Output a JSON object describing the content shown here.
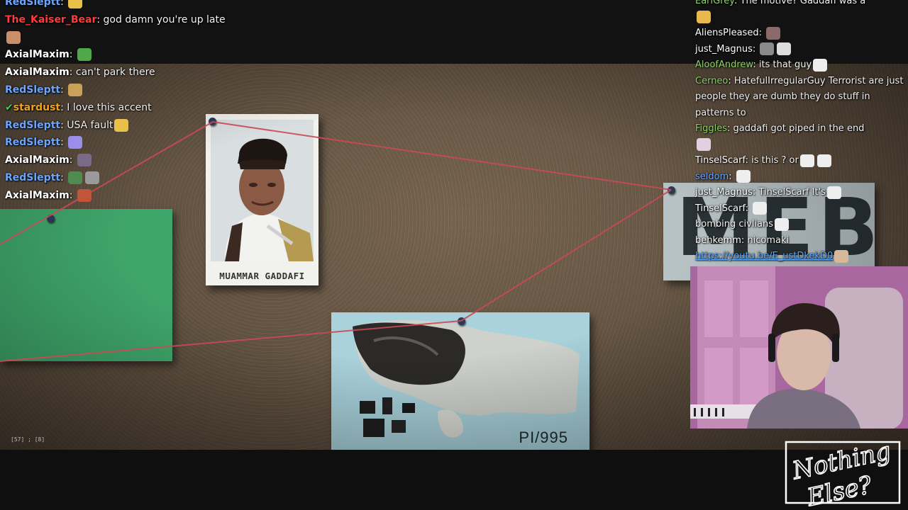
{
  "video": {
    "photo_caption": "MUAMMAR GADDAFI",
    "evidence_label": "PI/995",
    "sign_text": "MEBO",
    "timecode": "[57] ; [8]"
  },
  "chat_left": [
    {
      "user": "RedSleptt",
      "color": "#6aa6ff",
      "text": "",
      "emotes": [
        "#e8c04a"
      ]
    },
    {
      "user": "The_Kaiser_Bear",
      "color": "#ff3b3b",
      "text": "god damn you're up late",
      "emotes": [
        "#c98f6a"
      ]
    },
    {
      "user": "AxialMaxim",
      "color": "#ffffff",
      "text": "",
      "emotes": [
        "#4fa84a"
      ]
    },
    {
      "user": "AxialMaxim",
      "color": "#ffffff",
      "text": "can't park there",
      "emotes": []
    },
    {
      "user": "RedSleptt",
      "color": "#6aa6ff",
      "text": "",
      "emotes": [
        "#c9a25a"
      ]
    },
    {
      "user": "stardust",
      "color": "#f0a020",
      "text": "I love this accent",
      "emotes": [],
      "badge": "✔"
    },
    {
      "user": "RedSleptt",
      "color": "#6aa6ff",
      "text": "USA fault",
      "emotes": [
        "#e8c04a"
      ]
    },
    {
      "user": "RedSleptt",
      "color": "#6aa6ff",
      "text": "",
      "emotes": [
        "#9b8ee8"
      ]
    },
    {
      "user": "AxialMaxim",
      "color": "#ffffff",
      "text": "",
      "emotes": [
        "#7a6a8a"
      ]
    },
    {
      "user": "RedSleptt",
      "color": "#6aa6ff",
      "text": "",
      "emotes": [
        "#4f8a4f",
        "#9a9a9a"
      ]
    },
    {
      "user": "AxialMaxim",
      "color": "#ffffff",
      "text": "",
      "emotes": [
        "#c0553a"
      ]
    }
  ],
  "chat_right": [
    {
      "user": "EarlGrey",
      "color": "#8fd16a",
      "text": "The motive? Gaddafi was a",
      "emotes": []
    },
    {
      "user": "",
      "color": "#ffffff",
      "text": "",
      "emotes": [
        "#e8b84a"
      ]
    },
    {
      "user": "AliensPleased",
      "color": "#ffffff",
      "text": "",
      "emotes": [
        "#8a6a6a"
      ]
    },
    {
      "user": "just_Magnus",
      "color": "#ffffff",
      "text": "",
      "emotes": [
        "#8a8a8a",
        "#dddddd"
      ]
    },
    {
      "user": "AloofAndrew",
      "color": "#8fd16a",
      "text": "its that guy",
      "emotes": [
        "#eeeeee"
      ]
    },
    {
      "user": "Cerneo",
      "color": "#8fd16a",
      "text": "HatefulIrregularGuy Terrorist are just people they are dumb they do stuff in patterns to",
      "emotes": []
    },
    {
      "user": "Figgles",
      "color": "#8fd16a",
      "text": "gaddafi got piped in the end",
      "emotes": []
    },
    {
      "user": "",
      "color": "#ffffff",
      "text": "",
      "emotes": [
        "#e0d0e0"
      ]
    },
    {
      "user": "TinselScarf",
      "color": "#ffffff",
      "text": "is this ? or",
      "emotes": [
        "#eeeeee",
        "#eeeeee"
      ]
    },
    {
      "user": "seldom",
      "color": "#6aa6ff",
      "text": "",
      "emotes": [
        "#eeeeee"
      ]
    },
    {
      "user": "just_Magnus",
      "color": "#ffffff",
      "text": "TinselScarf It's",
      "emotes": [
        "#eeeeee"
      ]
    },
    {
      "user": "TinselScarf",
      "color": "#ffffff",
      "text": "",
      "emotes": [
        "#eeeeee"
      ]
    },
    {
      "user": "",
      "color": "#ffffff",
      "text": "bombing civlians",
      "emotes": [
        "#eeeeee"
      ]
    },
    {
      "user": "behkemm",
      "color": "#ffffff",
      "text": "nicomaki",
      "emotes": []
    },
    {
      "user": "",
      "color": "#5aa8ff",
      "text": "https://youtu.be/E_ustDkekD0",
      "emotes": [
        "#d8b89a"
      ],
      "link": true
    }
  ],
  "logo_text": "Nothing Else?",
  "colors": {
    "string": "#c94a55",
    "pin": "#2d3a55",
    "green_card": "#3fa66a",
    "evidence": "#a9d2dc"
  }
}
